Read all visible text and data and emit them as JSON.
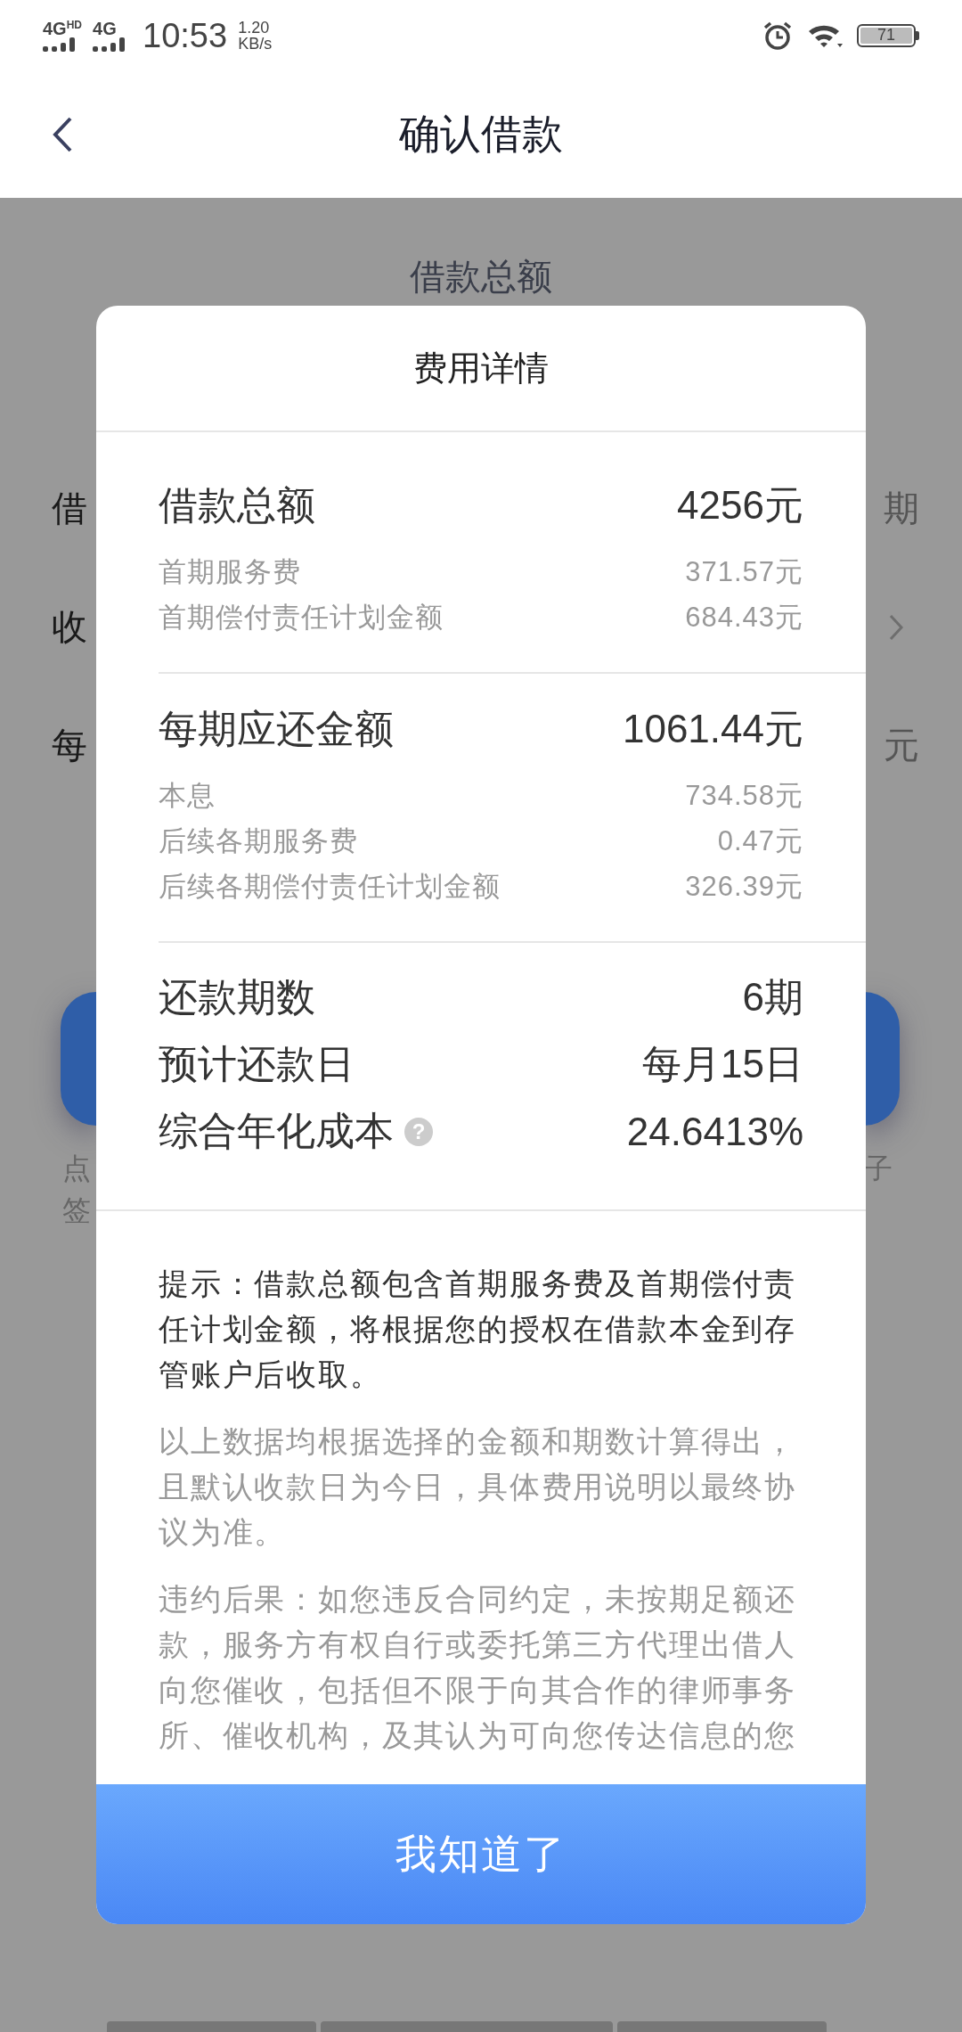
{
  "status_bar": {
    "networks": [
      {
        "label": "4G",
        "badge": "HD"
      },
      {
        "label": "4G"
      }
    ],
    "time": "10:53",
    "speed_value": "1.20",
    "speed_unit": "KB/s",
    "battery": "71"
  },
  "header": {
    "title": "确认借款"
  },
  "background_page": {
    "heading": "借款总额",
    "rows": [
      {
        "left": "借",
        "kind": "text",
        "right": "期"
      },
      {
        "left": "收",
        "kind": "chevron"
      },
      {
        "left": "每",
        "kind": "text",
        "right": "元"
      }
    ],
    "footnote_left": [
      "点",
      "签"
    ],
    "footnote_right": "子"
  },
  "dialog": {
    "title": "费用详情",
    "sections": [
      {
        "label": "借款总额",
        "value": "4256元",
        "items": [
          {
            "label": "首期服务费",
            "value": "371.57元"
          },
          {
            "label": "首期偿付责任计划金额",
            "value": "684.43元"
          }
        ]
      },
      {
        "label": "每期应还金额",
        "value": "1061.44元",
        "items": [
          {
            "label": "本息",
            "value": "734.58元"
          },
          {
            "label": "后续各期服务费",
            "value": "0.47元"
          },
          {
            "label": "后续各期偿付责任计划金额",
            "value": "326.39元"
          }
        ]
      }
    ],
    "summary": [
      {
        "label": "还款期数",
        "value": "6期"
      },
      {
        "label": "预计还款日",
        "value": "每月15日"
      },
      {
        "label": "综合年化成本",
        "value": "24.6413%",
        "help": "?"
      }
    ],
    "notes": [
      {
        "kind": "tip",
        "text": "提示：借款总额包含首期服务费及首期偿付责任计划金额，将根据您的授权在借款本金到存管账户后收取。"
      },
      {
        "kind": "muted",
        "text": "以上数据均根据选择的金额和期数计算得出，且默认收款日为今日，具体费用说明以最终协议为准。"
      },
      {
        "kind": "muted",
        "text": "违约后果：如您违反合同约定，未按期足额还款，服务方有权自行或委托第三方代理出借人向您催收，包括但不限于向其合作的律师事务所、催收机构，及其认为可向您传达信息的您"
      }
    ],
    "button": "我知道了"
  }
}
